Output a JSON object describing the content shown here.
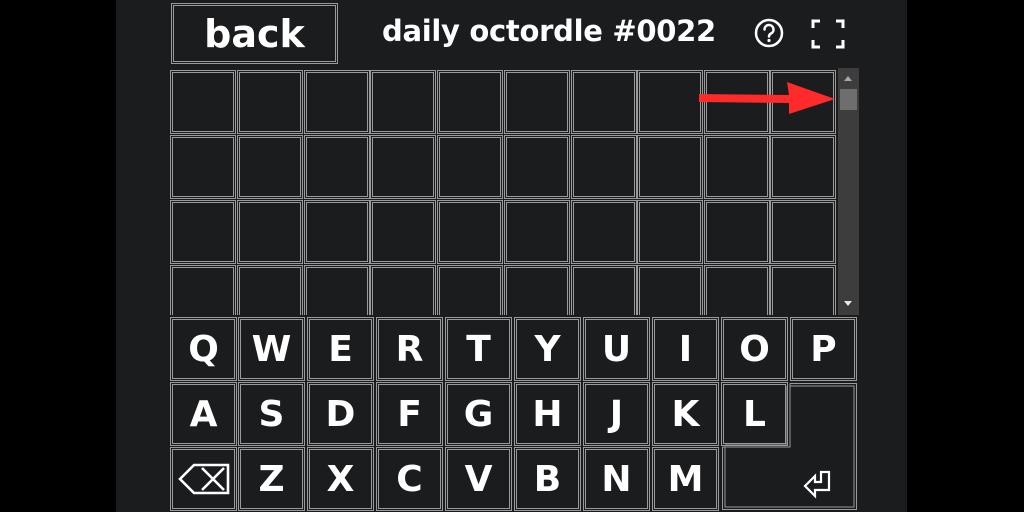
{
  "header": {
    "back_label": "back",
    "title": "daily octordle #0022",
    "help_icon": "question-circle-icon",
    "fullscreen_icon": "fullscreen-icon"
  },
  "board": {
    "columns": 10,
    "visible_rows": 4,
    "cells": [
      "",
      "",
      "",
      "",
      "",
      "",
      "",
      "",
      "",
      "",
      "",
      "",
      "",
      "",
      "",
      "",
      "",
      "",
      "",
      "",
      "",
      "",
      "",
      "",
      "",
      "",
      "",
      "",
      "",
      "",
      "",
      "",
      "",
      "",
      "",
      "",
      "",
      "",
      "",
      ""
    ]
  },
  "keyboard": {
    "row1": [
      "Q",
      "W",
      "E",
      "R",
      "T",
      "Y",
      "U",
      "I",
      "O",
      "P"
    ],
    "row2": [
      "A",
      "S",
      "D",
      "F",
      "G",
      "H",
      "J",
      "K",
      "L"
    ],
    "row3": [
      "Z",
      "X",
      "C",
      "V",
      "B",
      "N",
      "M"
    ],
    "backspace_icon": "backspace-icon",
    "enter_icon": "enter-icon"
  },
  "annotation": {
    "arrow_color": "#ff2a2a",
    "arrow_icon": "red-arrow-annotation"
  },
  "colors": {
    "background": "#1b1c1e",
    "border": "#9a9a9a",
    "text": "#ffffff"
  }
}
